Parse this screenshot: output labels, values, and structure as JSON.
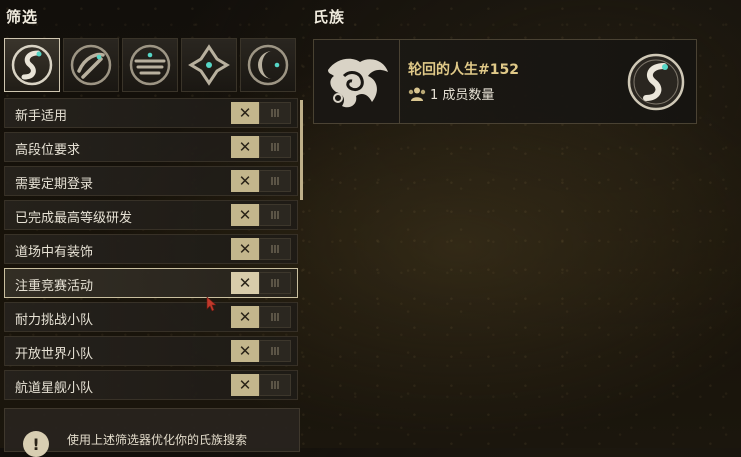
{
  "filter_panel": {
    "title": "筛选",
    "symbol_tabs": [
      {
        "icon": "moon-symbol-icon",
        "active": true
      },
      {
        "icon": "sun-symbol-icon",
        "active": false
      },
      {
        "icon": "void-symbol-icon",
        "active": false
      },
      {
        "icon": "storm-symbol-icon",
        "active": false
      },
      {
        "icon": "lunar-crescent-symbol-icon",
        "active": false
      }
    ],
    "filters": [
      {
        "label": "新手适用",
        "state": "off"
      },
      {
        "label": "高段位要求",
        "state": "off"
      },
      {
        "label": "需要定期登录",
        "state": "off"
      },
      {
        "label": "已完成最高等级研发",
        "state": "off"
      },
      {
        "label": "道场中有装饰",
        "state": "off"
      },
      {
        "label": "注重竞赛活动",
        "state": "off"
      },
      {
        "label": "耐力挑战小队",
        "state": "off"
      },
      {
        "label": "开放世界小队",
        "state": "off"
      },
      {
        "label": "航道星舰小队",
        "state": "off"
      }
    ],
    "off_glyph": "✕",
    "hint_icon_glyph": "!",
    "hint_text": "使用上述筛选器优化你的氏族搜索"
  },
  "clan_panel": {
    "title": "氏族",
    "clan": {
      "name": "轮回的人生#152",
      "members_text": "1 成员数量",
      "emblem_icon": "clan-emblem-icon",
      "badge_icon": "moon-symbol-icon"
    }
  },
  "colors": {
    "accent_gold": "#e0c988",
    "toggle_off": "#c3b68c",
    "panel_bg": "#1e1b16"
  }
}
